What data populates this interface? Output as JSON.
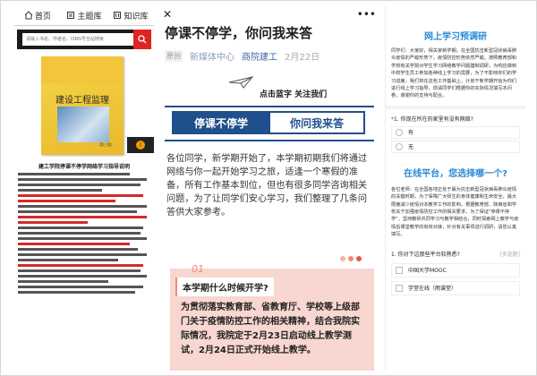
{
  "panel1": {
    "tabs": [
      {
        "label": "首页",
        "icon": "home-icon"
      },
      {
        "label": "主题库",
        "icon": "topic-icon"
      },
      {
        "label": "知识库",
        "icon": "knowledge-icon"
      }
    ],
    "search_placeholder": "请输入书名、作者名、ISBN号全站搜索",
    "book_title": "建设工程监理",
    "book_edition": "（第三版）",
    "doc_title": "建工学院停课不停学网络学习指导说明"
  },
  "panel2": {
    "title": "停课不停学，你问我来答",
    "original_tag": "原创",
    "source": "新媒体中心",
    "account": "商院建工",
    "date": "2月22日",
    "follow_text": "点击蓝字 关注我们",
    "banner_left": "停课不停学",
    "banner_right": "你问我来答",
    "paragraph": "各位同学，新学期开始了，本学期初期我们将通过网络与你一起开始学习之旅，适逢一个寒假的准备，所有工作基本到位，但也有很多同学咨询相关问题，为了让同学们安心学习，我们整理了几条问答供大家参考。",
    "card_num": "01",
    "card_q": "本学期什么时候开学?",
    "card_answer": "为贯彻落实教育部、省教育厅、学校等上级部门关于疫情防控工作的相关精神，结合我院实际情况，我院定于2月23日启动线上教学测试，2月24日正式开始线上教学。",
    "dot_colors": [
      "#f2b5a5",
      "#f08a7a",
      "#e05a4a"
    ]
  },
  "panel3": {
    "title": "网上学习预调研",
    "intro": "同学们：大家好，相关家新学期。在全国抗击新型冠状病毒肺炎疫情的严峻形势下，疫情防控形势依然严峻。按照教育部和学校有关学院对学生学习网络教学问题建制调研，为响应做到中校学生员工参加各种线上学习的需要，为了不影响你们的学习进度，我们将在这些工作基础上，计划于新学期开始为你们进行线上学习指导，现请同学们根据你的实际情况填写本问卷，谢谢你的支持与配合。",
    "q1": "1. 你现在所在的家里有没有网络?",
    "q1_options": [
      "有",
      "无"
    ],
    "subtitle": "在线平台，您选择哪一个?",
    "text2": "各位老师：在全国各地正处于最为抗击新型冠状病毒肺炎疫情的关键时期，为了保障广大师生的身体健康和生命安全，最大限度减少疫情对本教学工作的影响，根据教育部、陕西省和学校关于加强疫情防控工作的相关要求，为了保证\"停课不停学\"，坚持教师共同学习与教学相结合，同时探索网上教学与疫情后课堂教学的有效对接，针对有关事项进行调研，请您认真填写。",
    "q2": "1. 你对下边那些平台较熟悉?",
    "q2_tag": "[多选题]",
    "q2_options": [
      "中国大学MOOC",
      "学堂在线（雨课堂）"
    ]
  }
}
